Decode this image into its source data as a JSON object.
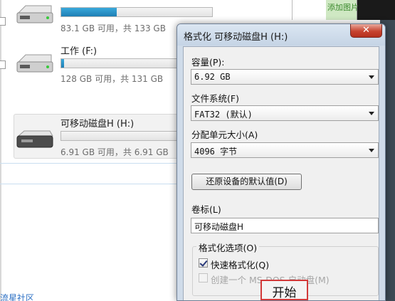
{
  "explorer": {
    "drives": [
      {
        "name": "",
        "capacity": "83.1 GB 可用，共 133 GB",
        "used_fraction": 0.37
      },
      {
        "name": "工作 (F:)",
        "capacity": "128 GB 可用，共 131 GB",
        "used_fraction": 0.02
      },
      {
        "name": "可移动磁盘H (H:)",
        "capacity": "6.91 GB 可用，共 6.91 GB",
        "used_fraction": 0.0
      }
    ],
    "watermark": "流星社区",
    "top_right_text": "添加图片"
  },
  "dialog": {
    "title": "格式化 可移动磁盘H (H:)",
    "close_glyph": "✕",
    "capacity_label": "容量(P):",
    "capacity_value": "6.92 GB",
    "filesystem_label": "文件系统(F)",
    "filesystem_value": "FAT32 (默认)",
    "alloc_label": "分配单元大小(A)",
    "alloc_value": "4096 字节",
    "restore_button": "还原设备的默认值(D)",
    "volume_label": "卷标(L)",
    "volume_value": "可移动磁盘H",
    "options_title": "格式化选项(O)",
    "quick_format": {
      "label": "快速格式化(Q)",
      "checked": true
    },
    "msdos_disk": {
      "label": "创建一个 MS-DOS 启动盘(M)",
      "checked": false,
      "disabled": true
    },
    "start_button": "开始"
  },
  "colors": {
    "accent_bar": "#2a93cc",
    "annotation_red": "#d23a3a",
    "close_red": "#c7432f"
  }
}
